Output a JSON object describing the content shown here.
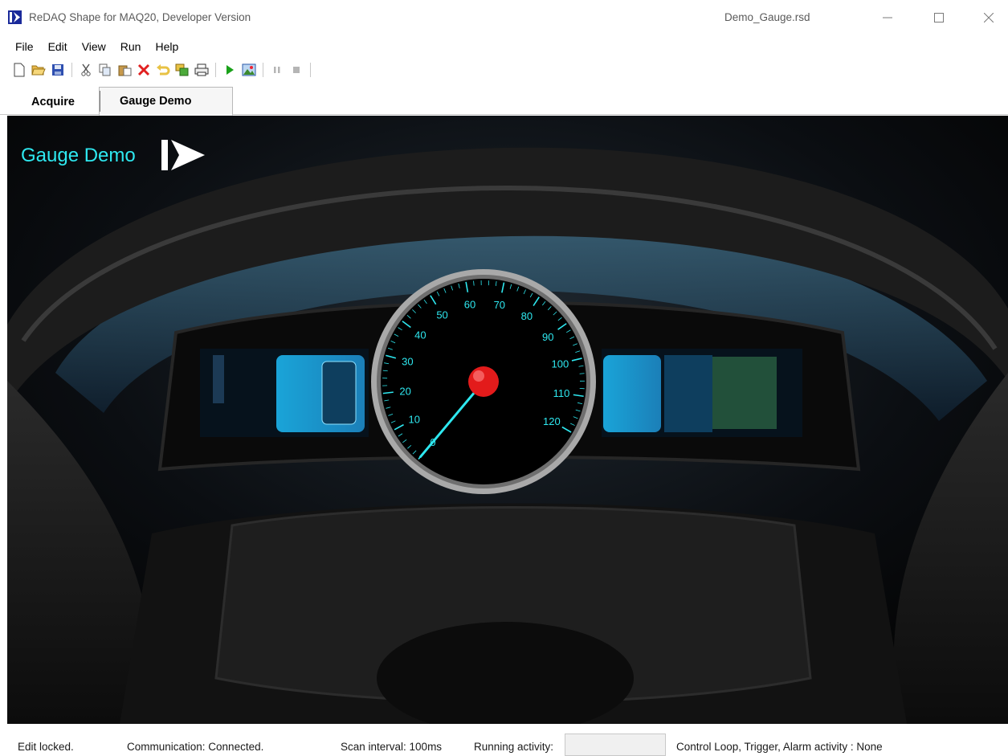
{
  "window": {
    "app_title": "ReDAQ Shape for MAQ20, Developer Version",
    "document_title": "Demo_Gauge.rsd",
    "controls": {
      "minimize": "—",
      "maximize": "☐",
      "close": "✕"
    }
  },
  "menu": {
    "items": [
      "File",
      "Edit",
      "View",
      "Run",
      "Help"
    ]
  },
  "toolbar": {
    "buttons": [
      "new-icon",
      "open-icon",
      "save-icon",
      "cut-icon",
      "copy-icon",
      "paste-icon",
      "delete-icon",
      "undo-icon",
      "duplicate-icon",
      "print-icon",
      "run-icon",
      "image-icon",
      "pause-icon",
      "stop-icon"
    ]
  },
  "tabs": [
    {
      "label": "Acquire",
      "active": false
    },
    {
      "label": "Gauge Demo",
      "active": true
    }
  ],
  "canvas": {
    "title": "Gauge Demo"
  },
  "gauge": {
    "tick_labels": [
      "0",
      "10",
      "20",
      "30",
      "40",
      "50",
      "60",
      "70",
      "80",
      "90",
      "100",
      "110",
      "120"
    ],
    "min": 0,
    "max": 120,
    "value": 0,
    "accent_color": "#2ee8f0",
    "needle_cap_color": "#e31b1b"
  },
  "status": {
    "edit": "Edit locked.",
    "communication": "Communication: Connected.",
    "scan_interval": "Scan interval: 100ms",
    "running_activity": "Running activity:",
    "control_loop": "Control Loop, Trigger, Alarm activity : None"
  }
}
